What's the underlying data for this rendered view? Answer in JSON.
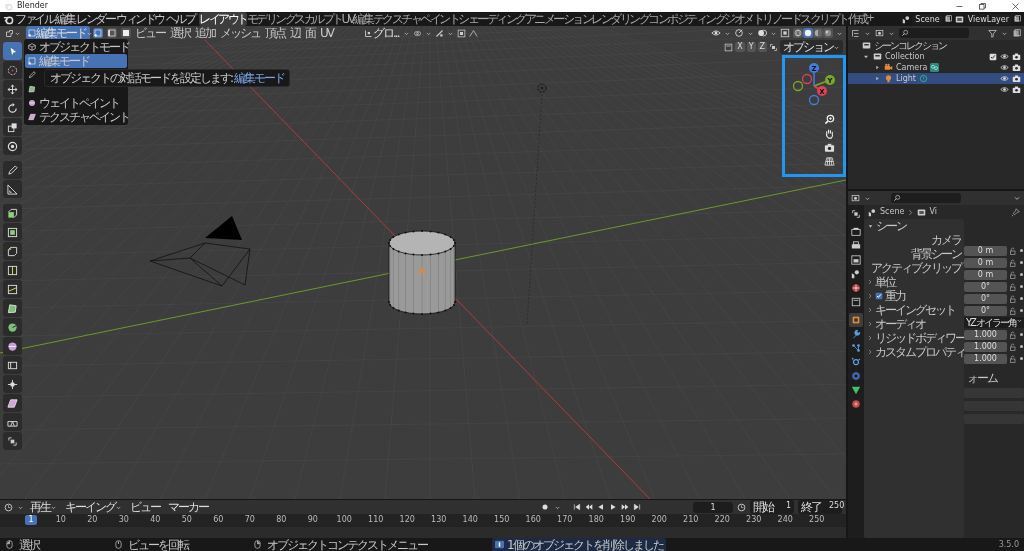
{
  "window": {
    "title": "Blender"
  },
  "menu": [
    "ファイル",
    "編集",
    "レンダー",
    "ウィンドウ",
    "ヘルプ"
  ],
  "workspaces": [
    {
      "label": "レイアウト",
      "selected": true
    },
    {
      "label": "モデリング",
      "selected": false
    },
    {
      "label": "スカルプト",
      "selected": false
    },
    {
      "label": "UV編集",
      "selected": false
    },
    {
      "label": "テクスチャペイント",
      "selected": false
    },
    {
      "label": "シェーディング",
      "selected": false
    },
    {
      "label": "アニメーション",
      "selected": false
    },
    {
      "label": "レンダリング",
      "selected": false
    },
    {
      "label": "コンポジティング",
      "selected": false
    },
    {
      "label": "ジオメトリノード",
      "selected": false
    },
    {
      "label": "スクリプト作成",
      "selected": false
    }
  ],
  "add_workspace": "+",
  "scene": "Scene",
  "view_layer": "ViewLayer",
  "header": {
    "mode": "編集モード",
    "mode_open": true,
    "select_modes": [
      {
        "selected": true
      },
      {
        "selected": false
      },
      {
        "selected": false
      }
    ],
    "menus": [
      "ビュー",
      "選択",
      "追加",
      "メッシュ",
      "頂点",
      "辺",
      "面",
      "UV"
    ],
    "orientation": "グロ...",
    "shading": [
      {
        "selected": false
      },
      {
        "selected": true
      },
      {
        "selected": false
      },
      {
        "selected": false
      }
    ]
  },
  "mode_menu": [
    {
      "kind": "item",
      "label": "オブジェクトモード",
      "selected": false
    },
    {
      "kind": "item",
      "label": "編集モード",
      "selected": true
    },
    {
      "kind": "covered"
    },
    {
      "kind": "covered"
    },
    {
      "kind": "item",
      "label": "ウェイトペイント",
      "selected": false
    },
    {
      "kind": "item",
      "label": "テクスチャペイント",
      "selected": false
    }
  ],
  "tooltip": {
    "text": "オブジェクトの対話モードを設定します:",
    "value": "編集モード"
  },
  "toolbar": [
    {
      "selected": true
    },
    {
      "selected": false
    },
    {
      "selected": false
    },
    {
      "selected": false
    },
    {
      "selected": false
    },
    {
      "selected": false
    },
    {
      "selected": false
    },
    {
      "selected": false
    },
    {
      "selected": false
    },
    {
      "selected": false
    },
    {
      "selected": false
    },
    {
      "selected": false
    },
    {
      "selected": false
    },
    {
      "selected": false
    },
    {
      "selected": false
    },
    {
      "selected": false
    },
    {
      "selected": false
    },
    {
      "selected": false
    },
    {
      "selected": false
    },
    {
      "selected": false
    },
    {
      "selected": false
    }
  ],
  "viewport": {
    "axis_toggles": [
      "X",
      "Y",
      "Z"
    ],
    "options": "オプション",
    "gizmo_axes": [
      "Z",
      "Y",
      "X"
    ]
  },
  "outliner": {
    "root": "シーンコレクション",
    "tree": [
      {
        "label": "Collection",
        "checked": true,
        "expanded": true,
        "children": [
          {
            "label": "Camera",
            "kind": "camera",
            "selected": false,
            "expanded": false
          },
          {
            "label": "Light",
            "kind": "light",
            "selected": true,
            "expanded": false
          }
        ]
      }
    ]
  },
  "properties": {
    "breadcrumb": [
      "Scene",
      "Vi"
    ],
    "panel": "シーン",
    "fields": [
      "カメラ",
      "背景シーン",
      "アクティブクリップ"
    ],
    "sections": [
      {
        "label": "単位",
        "kind": "plain"
      },
      {
        "label": "重力",
        "kind": "checkbox",
        "checked": true
      },
      {
        "label": "キーイングセット",
        "kind": "plain"
      },
      {
        "label": "オーディオ",
        "kind": "plain"
      },
      {
        "label": "リジッドボディワー",
        "kind": "plain"
      },
      {
        "label": "カスタムプロパティ",
        "kind": "plain"
      }
    ],
    "location": [
      "0 m",
      "0 m",
      "0 m"
    ],
    "rotation": [
      "0°",
      "0°",
      "0°"
    ],
    "rotation_mode": "YZ オイラー角",
    "scale": [
      "1.000",
      "1.000",
      "1.000"
    ],
    "subpanel": "ォーム"
  },
  "timeline": {
    "menus": [
      {
        "label": "再生",
        "dropdown": true
      },
      {
        "label": "キーイング",
        "dropdown": true
      },
      {
        "label": "ビュー",
        "dropdown": false
      },
      {
        "label": "マーカー",
        "dropdown": false
      }
    ],
    "current_frame": "1",
    "start_label": "開始",
    "start": "1",
    "end_label": "終了",
    "end": "250",
    "playhead": "1",
    "ruler": [
      "10",
      "20",
      "30",
      "40",
      "50",
      "60",
      "70",
      "80",
      "90",
      "100",
      "110",
      "120",
      "130",
      "140",
      "150",
      "160",
      "170",
      "180",
      "190",
      "200",
      "210",
      "220",
      "230",
      "240",
      "250"
    ]
  },
  "status_bar": {
    "hints": [
      "選択",
      "ビューを回転",
      "オブジェクトコンテクストメニュー"
    ],
    "notice": "1個のオブジェクトを削除しました",
    "version": "3.5.0"
  }
}
